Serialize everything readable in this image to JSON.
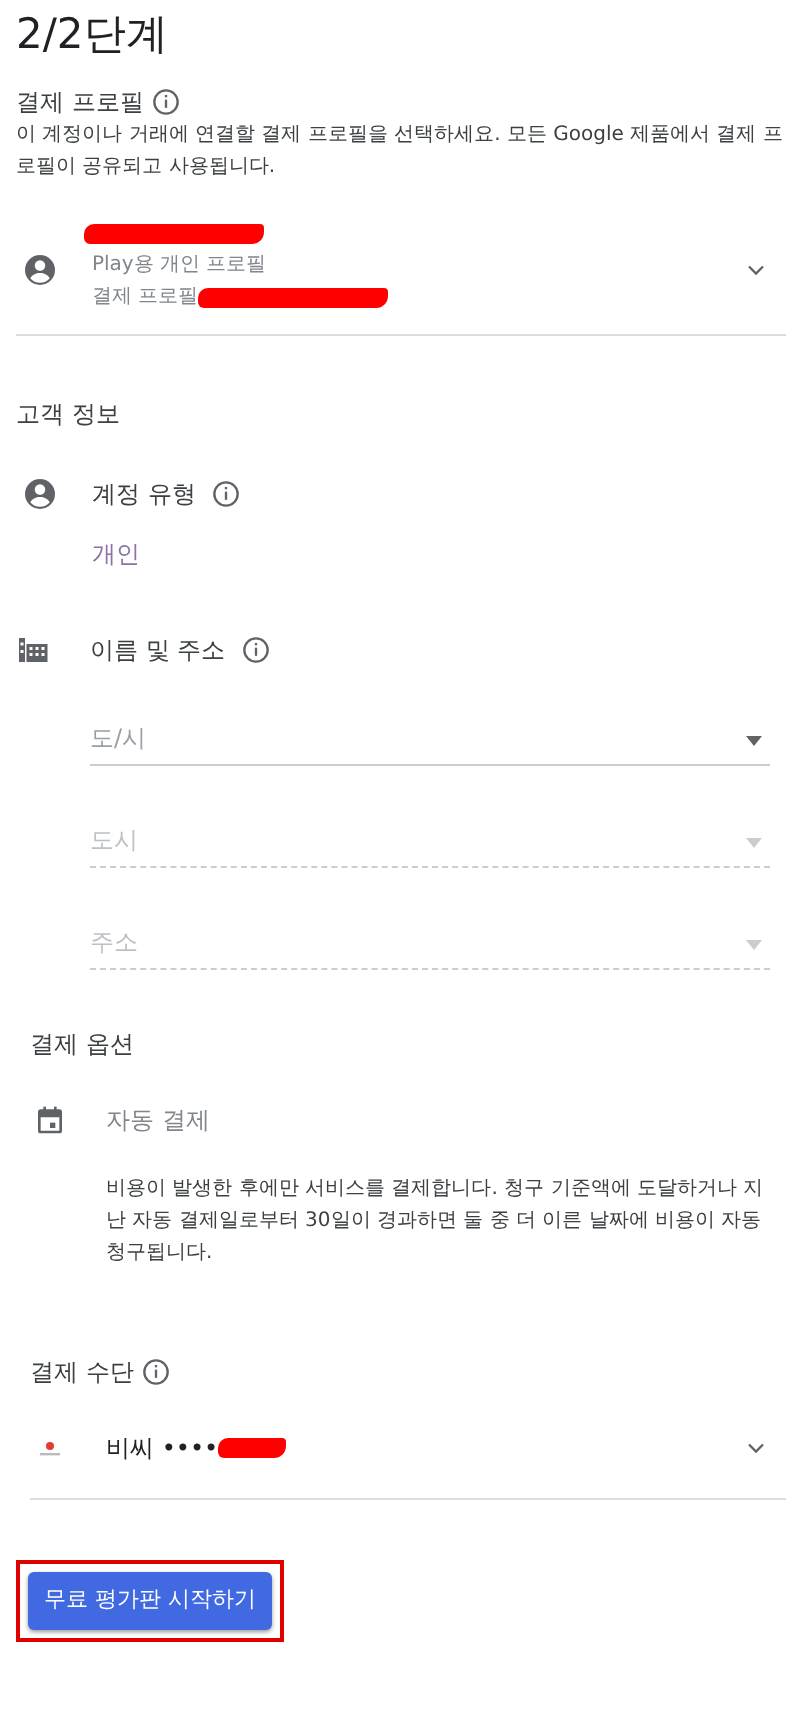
{
  "step_title": "2/2단계",
  "billing_profile": {
    "title": "결제 프로필",
    "description": "이 계정이나 거래에 연결할 결제 프로필을 선택하세요. 모든 Google 제품에서 결제 프로필이 공유되고 사용됩니다.",
    "profile_name": "Play용 개인 프로필",
    "profile_id_label": "결제 프로필"
  },
  "customer_info": {
    "title": "고객 정보",
    "account_type_label": "계정 유형",
    "account_type_value": "개인",
    "name_address_label": "이름 및 주소",
    "fields": [
      {
        "placeholder": "도/시",
        "disabled": false
      },
      {
        "placeholder": "도시",
        "disabled": true
      },
      {
        "placeholder": "주소",
        "disabled": true
      }
    ]
  },
  "payment_options": {
    "title": "결제 옵션",
    "option": "자동 결제",
    "description": "비용이 발생한 후에만 서비스를 결제합니다. 청구 기준액에 도달하거나 지난 자동 결제일로부터 30일이 경과하면 둘 중 더 이른 날짜에 비용이 자동 청구됩니다."
  },
  "payment_method": {
    "title": "결제 수단",
    "card": "비씨 ••••"
  },
  "submit": {
    "label": "무료 평가판 시작하기",
    "highlighted": true
  }
}
